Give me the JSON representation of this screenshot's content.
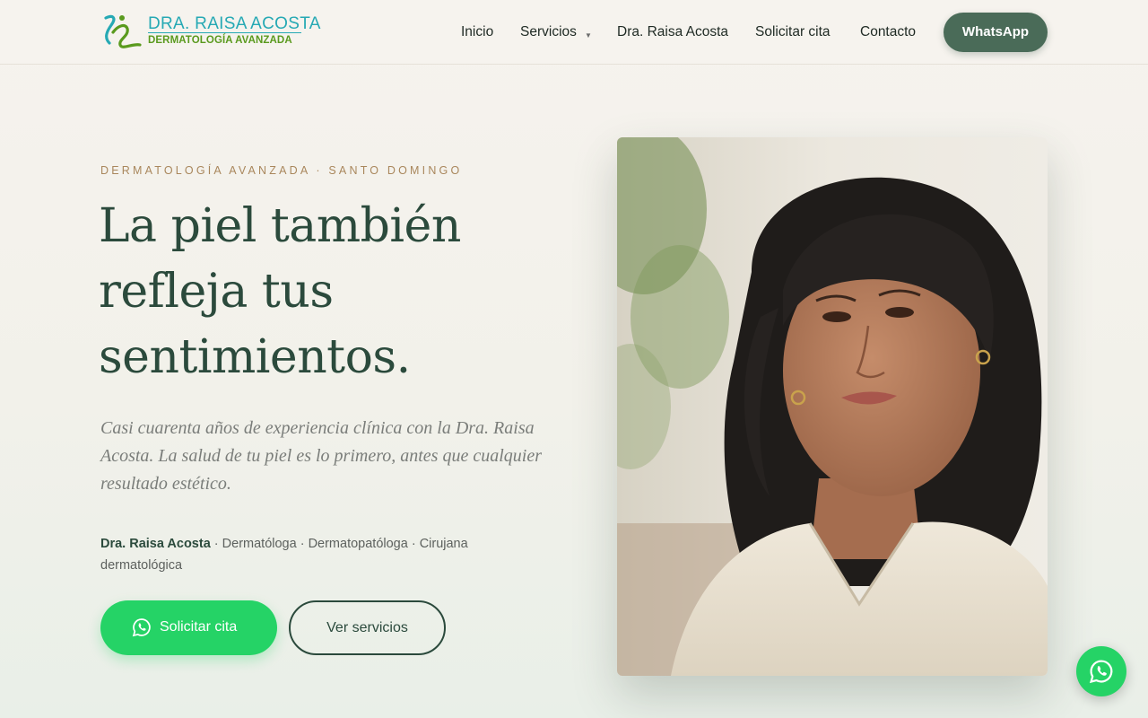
{
  "brand": {
    "name": "DRA. RAISA ACOSTA",
    "tagline": "DERMATOLOGÍA AVANZADA",
    "colors": {
      "teal": "#26a9b4",
      "green": "#5a9a1e"
    }
  },
  "nav": {
    "items": [
      {
        "label": "Inicio"
      },
      {
        "label": "Servicios",
        "has_dropdown": true
      },
      {
        "label": "Dra. Raisa Acosta"
      },
      {
        "label": "Solicitar cita"
      },
      {
        "label": "Contacto"
      }
    ],
    "whatsapp_label": "WhatsApp"
  },
  "hero": {
    "eyebrow": "DERMATOLOGÍA AVANZADA · SANTO DOMINGO",
    "headline": {
      "line1": "La piel también",
      "line2": "refleja tus",
      "line3": "sentimientos."
    },
    "lead": "Casi cuarenta años de experiencia clínica con la Dra. Raisa Acosta. La salud de tu piel es lo primero, antes que cualquier resultado estético.",
    "credentials": {
      "name": "Dra. Raisa Acosta",
      "roles": " · Dermatóloga · Dermatopatóloga · Cirujana dermatológica"
    },
    "cta_primary": "Solicitar cita",
    "cta_secondary": "Ver servicios"
  },
  "icons": {
    "whatsapp": "whatsapp-icon",
    "dropdown": "chevron-down-icon",
    "floating": "whatsapp-icon"
  },
  "colors": {
    "primary_dark": "#2b4a3c",
    "nav_button": "#4a6b58",
    "whatsapp_green": "#25d366",
    "eyebrow_gold": "#a9875c"
  }
}
